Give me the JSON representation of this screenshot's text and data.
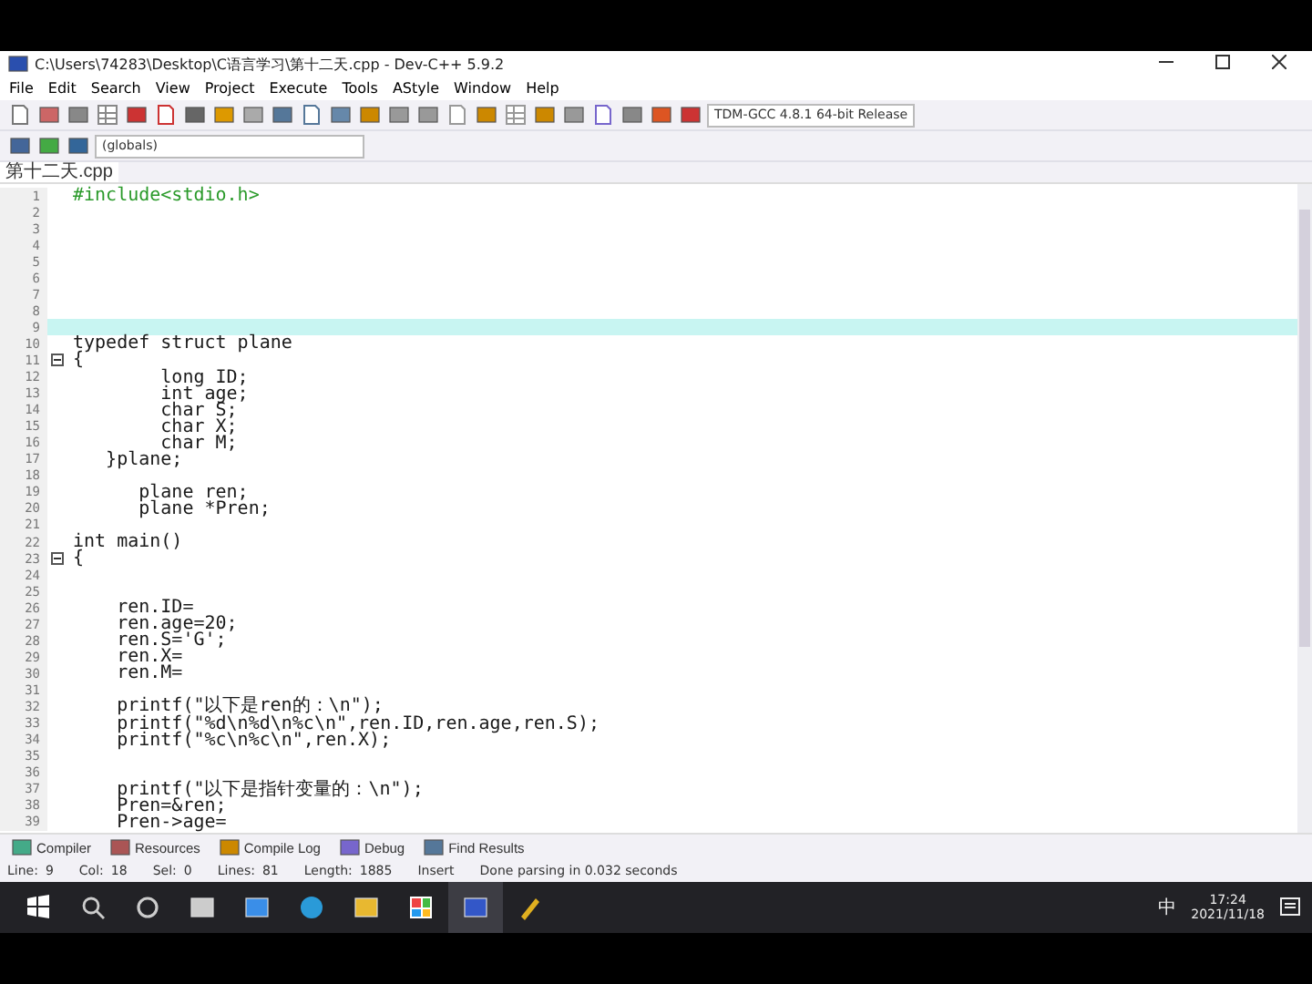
{
  "window": {
    "title": "C:\\Users\\74283\\Desktop\\C语言学习\\第十二天.cpp - Dev-C++ 5.9.2"
  },
  "menu": [
    "File",
    "Edit",
    "Search",
    "View",
    "Project",
    "Execute",
    "Tools",
    "AStyle",
    "Window",
    "Help"
  ],
  "toolbar": {
    "compiler": "TDM-GCC 4.8.1 64-bit Release",
    "scope": "(globals)"
  },
  "file_tabs": [
    {
      "label": "第十二天.cpp",
      "selected": true
    }
  ],
  "editor": {
    "lines": [
      {
        "n": "1",
        "text": "#include<stdio.h>",
        "kind": "preproc"
      },
      {
        "n": "2"
      },
      {
        "n": "3"
      },
      {
        "n": "4"
      },
      {
        "n": "5"
      },
      {
        "n": "6"
      },
      {
        "n": "7"
      },
      {
        "n": "8"
      },
      {
        "n": "9",
        "current": true
      },
      {
        "n": "10",
        "text": "typedef struct plane",
        "kind": "code"
      },
      {
        "n": "11",
        "text": "{",
        "kind": "code",
        "fold_open": true
      },
      {
        "n": "12",
        "text": "        long ID;",
        "kind": "code"
      },
      {
        "n": "13",
        "text": "        int age;",
        "kind": "code"
      },
      {
        "n": "14",
        "text": "        char S;",
        "kind": "code"
      },
      {
        "n": "15",
        "text": "        char X;",
        "kind": "code"
      },
      {
        "n": "16",
        "text": "        char M;",
        "kind": "code"
      },
      {
        "n": "17",
        "text": "   }plane;",
        "kind": "code"
      },
      {
        "n": "18"
      },
      {
        "n": "19",
        "text": "      plane ren;",
        "kind": "code"
      },
      {
        "n": "20",
        "text": "      plane *Pren;",
        "kind": "code"
      },
      {
        "n": "21"
      },
      {
        "n": "22",
        "text": "int main()",
        "kind": "code"
      },
      {
        "n": "23",
        "text": "{",
        "kind": "code",
        "fold_open": true
      },
      {
        "n": "24"
      },
      {
        "n": "25"
      },
      {
        "n": "26",
        "text": "    ren.ID=",
        "kind": "code"
      },
      {
        "n": "27",
        "text": "    ren.age=20;",
        "kind": "code"
      },
      {
        "n": "28",
        "text": "    ren.S='G';",
        "kind": "code"
      },
      {
        "n": "29",
        "text": "    ren.X=",
        "kind": "code"
      },
      {
        "n": "30",
        "text": "    ren.M=",
        "kind": "code"
      },
      {
        "n": "31"
      },
      {
        "n": "32",
        "text": "    printf(\"以下是ren的：\\n\");",
        "kind": "code"
      },
      {
        "n": "33",
        "text": "    printf(\"%d\\n%d\\n%c\\n\",ren.ID,ren.age,ren.S);",
        "kind": "code"
      },
      {
        "n": "34",
        "text": "    printf(\"%c\\n%c\\n\",ren.X);",
        "kind": "code"
      },
      {
        "n": "35"
      },
      {
        "n": "36"
      },
      {
        "n": "37",
        "text": "    printf(\"以下是指针变量的：\\n\");",
        "kind": "code"
      },
      {
        "n": "38",
        "text": "    Pren=&ren;",
        "kind": "code"
      },
      {
        "n": "39",
        "text": "    Pren->age=",
        "kind": "code"
      }
    ]
  },
  "bottom_tabs": [
    {
      "label": "Compiler",
      "selected": false
    },
    {
      "label": "Resources",
      "selected": false
    },
    {
      "label": "Compile Log",
      "selected": false
    },
    {
      "label": "Debug",
      "selected": false
    },
    {
      "label": "Find Results",
      "selected": false
    }
  ],
  "status_bar": [
    {
      "label": "Line:",
      "value": "9"
    },
    {
      "label": "Col:",
      "value": "18"
    },
    {
      "label": "Sel:",
      "value": "0"
    },
    {
      "label": "Lines:",
      "value": "81"
    },
    {
      "label": "Length:",
      "value": "1885"
    },
    {
      "label": "Insert"
    },
    {
      "label": "Done parsing in 0.032 seconds"
    }
  ],
  "taskbar": {
    "ime": "中",
    "time": "17:24",
    "date": "2021/11/18"
  }
}
